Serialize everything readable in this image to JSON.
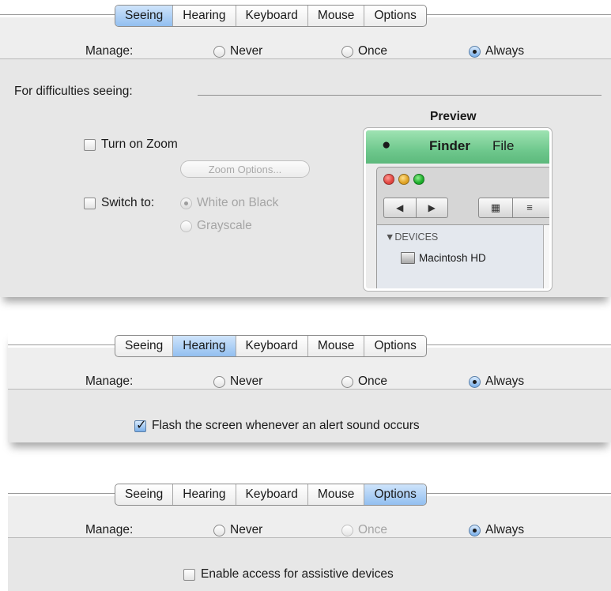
{
  "tabs": [
    "Seeing",
    "Hearing",
    "Keyboard",
    "Mouse",
    "Options"
  ],
  "manage": {
    "label": "Manage:",
    "options": [
      "Never",
      "Once",
      "Always"
    ]
  },
  "panels": [
    {
      "selected_tab": "Seeing",
      "manage_selected": "Always",
      "once_disabled": false
    },
    {
      "selected_tab": "Hearing",
      "manage_selected": "Always",
      "once_disabled": false
    },
    {
      "selected_tab": "Options",
      "manage_selected": "Always",
      "once_disabled": true
    }
  ],
  "seeing": {
    "heading": "For difficulties seeing:",
    "preview_title": "Preview",
    "zoom_checkbox": "Turn on Zoom",
    "zoom_checked": false,
    "zoom_options_button": "Zoom Options...",
    "switch_checkbox": "Switch to:",
    "switch_checked": false,
    "switch_options": [
      "White on Black",
      "Grayscale"
    ],
    "switch_selected": "White on Black",
    "preview": {
      "app_menu": "Finder",
      "menu_item": "File",
      "sidebar_header": "DEVICES",
      "sidebar_item": "Macintosh HD",
      "traffic_colors": [
        "#e0443e",
        "#dea123",
        "#1aab29"
      ]
    }
  },
  "hearing": {
    "flash_checkbox": "Flash the screen whenever an alert sound occurs",
    "flash_checked": true
  },
  "options": {
    "assistive_checkbox": "Enable access for assistive devices",
    "assistive_checked": false
  }
}
